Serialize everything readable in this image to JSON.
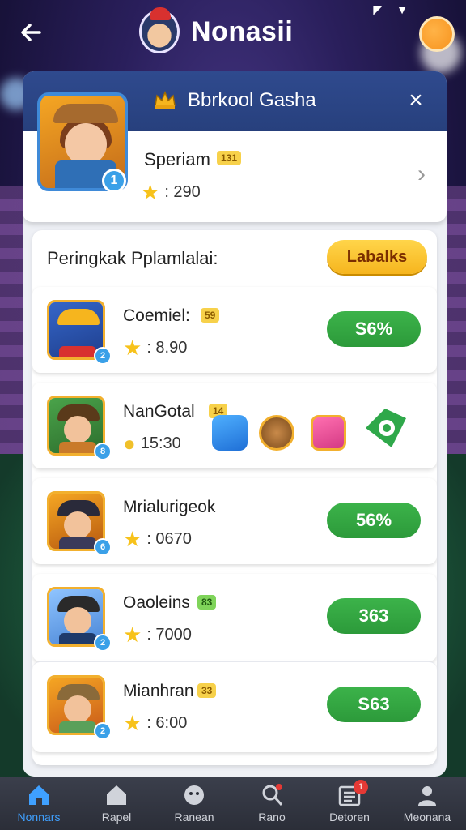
{
  "topbar": {
    "title": "Nonasii",
    "back_icon": "back-arrow-icon"
  },
  "panel": {
    "title": "Bbrkool Gasha",
    "close_symbol": "×"
  },
  "profile": {
    "name": "Speriam",
    "level": "131",
    "score": ": 290",
    "avatar_badge": "1",
    "chevron": "›"
  },
  "ranking": {
    "title": "Peringkak Pplamlalai:",
    "button_label": "Labalks",
    "rows": [
      {
        "name": "Coemiel:",
        "level": "59",
        "score": ": 8.90",
        "button": "S6%",
        "badge": "2"
      },
      {
        "name": "NanGotal",
        "level": "14",
        "score": "15:30",
        "badge": "8"
      },
      {
        "name": "Mrialurigeok",
        "level": "",
        "score": ": 0670",
        "button": "56%",
        "badge": "6"
      },
      {
        "name": "Oaoleins",
        "level": "83",
        "score": ": 7000",
        "button": "363",
        "badge": "2"
      },
      {
        "name": "Mianhran",
        "level": "33",
        "score": ": 6:00",
        "button": "S63",
        "badge": "2"
      }
    ]
  },
  "bottom_nav": {
    "items": [
      {
        "label": "Nonnars",
        "icon": "home-icon",
        "active": true
      },
      {
        "label": "Rapel",
        "icon": "house-icon",
        "active": false
      },
      {
        "label": "Ranean",
        "icon": "face-icon",
        "active": false
      },
      {
        "label": "Rano",
        "icon": "search-user-icon",
        "active": false,
        "badge": ""
      },
      {
        "label": "Detoren",
        "icon": "list-icon",
        "active": false,
        "badge": "1"
      },
      {
        "label": "Meonana",
        "icon": "user-icon",
        "active": false
      }
    ]
  },
  "colors": {
    "accent_blue": "#3fa0ff",
    "green_button": "#2c9a3a",
    "yellow_button": "#f6b51e",
    "header_blue": "#2f4a8e"
  }
}
